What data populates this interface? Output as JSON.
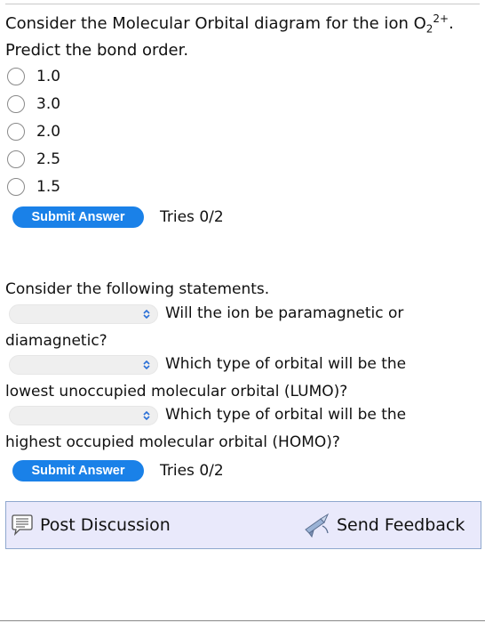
{
  "question1": {
    "line1_text": "Consider the Molecular Orbital diagram for the ion O",
    "ion_subscript": "2",
    "ion_superscript": "2+",
    "line1_end": ".",
    "line2_text": "Predict the bond order.",
    "options": [
      "1.0",
      "3.0",
      "2.0",
      "2.5",
      "1.5"
    ],
    "submit_label": "Submit Answer",
    "tries": "Tries 0/2"
  },
  "question2": {
    "intro": "Consider the following statements.",
    "statements": [
      {
        "selected_value": "",
        "text_line1": "Will the ion be paramagnetic or",
        "text_line2": "diamagnetic?"
      },
      {
        "selected_value": "",
        "text_line1": "Which type of orbital will be the",
        "text_line2": "lowest unoccupied molecular orbital (LUMO)?"
      },
      {
        "selected_value": "",
        "text_line1": "Which type of orbital will be the",
        "text_line2": "highest occupied molecular orbital (HOMO)?"
      }
    ],
    "submit_label": "Submit Answer",
    "tries": "Tries 0/2"
  },
  "footer": {
    "post_discussion_label": "Post Discussion",
    "post_discussion_icon": "discussion-bubble-icon",
    "send_feedback_label": "Send Feedback",
    "send_feedback_icon": "send-feedback-icon"
  },
  "colors": {
    "accent": "#1a81e8",
    "footer_background": "#e9e9fb",
    "footer_border": "#8fa8ce",
    "dropdown_background": "#efefef"
  }
}
